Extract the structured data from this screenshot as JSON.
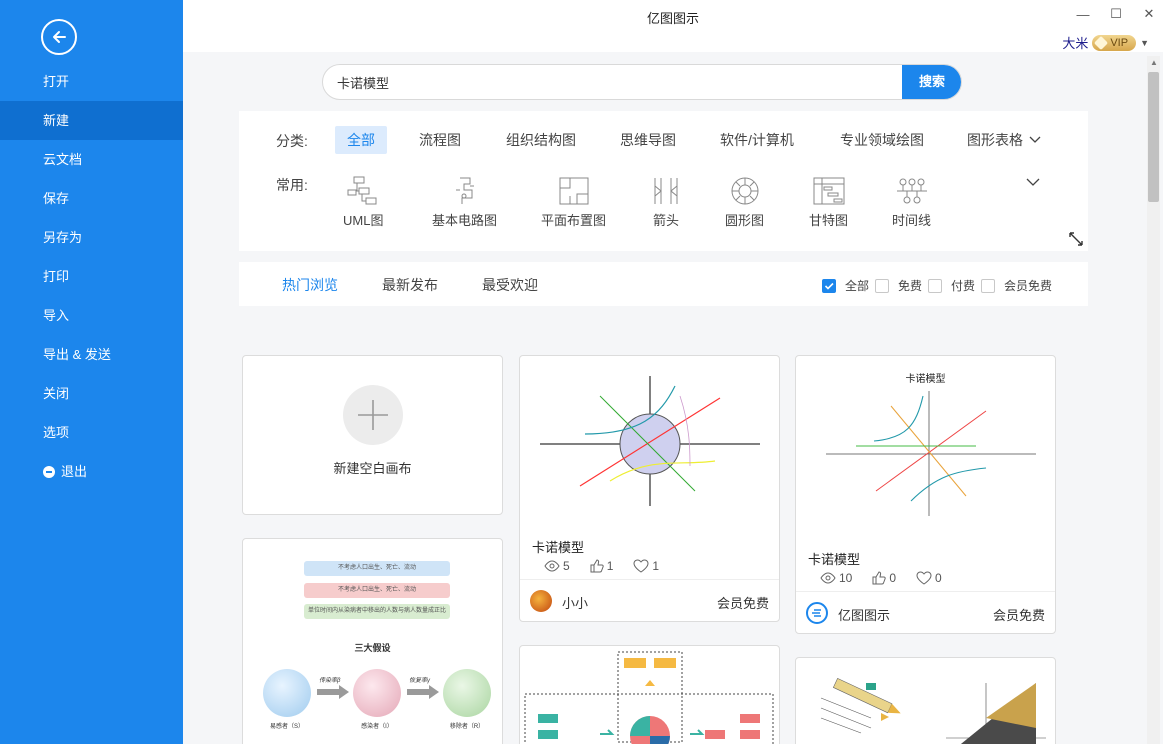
{
  "app": {
    "title": "亿图图示"
  },
  "window_controls": {
    "minimize": "—",
    "maximize": "☐",
    "close": "✕"
  },
  "user": {
    "name": "大米",
    "badge": "VIP"
  },
  "sidebar": {
    "items": [
      {
        "label": "打开"
      },
      {
        "label": "新建",
        "active": true
      },
      {
        "label": "云文档"
      },
      {
        "label": "保存"
      },
      {
        "label": "另存为"
      },
      {
        "label": "打印"
      },
      {
        "label": "导入"
      },
      {
        "label": "导出 & 发送"
      },
      {
        "label": "关闭"
      },
      {
        "label": "选项"
      },
      {
        "label": "退出"
      }
    ]
  },
  "search": {
    "value": "卡诺模型",
    "button": "搜索"
  },
  "categories": {
    "label": "分类:",
    "items": [
      "全部",
      "流程图",
      "组织结构图",
      "思维导图",
      "软件/计算机",
      "专业领域绘图",
      "图形表格"
    ]
  },
  "common": {
    "label": "常用:",
    "items": [
      "UML图",
      "基本电路图",
      "平面布置图",
      "箭头",
      "圆形图",
      "甘特图",
      "时间线"
    ]
  },
  "sort": {
    "tabs": [
      "热门浏览",
      "最新发布",
      "最受欢迎"
    ]
  },
  "filters": [
    {
      "label": "全部",
      "checked": true
    },
    {
      "label": "免费",
      "checked": false
    },
    {
      "label": "付费",
      "checked": false
    },
    {
      "label": "会员免费",
      "checked": false
    }
  ],
  "blank": {
    "label": "新建空白画布"
  },
  "templates": [
    {
      "title": "卡诺模型",
      "views": "5",
      "likes": "1",
      "favorites": "1",
      "author": "小小",
      "price": "会员免费"
    },
    {
      "title": "卡诺模型",
      "views": "10",
      "likes": "0",
      "favorites": "0",
      "author": "亿图图示",
      "price": "会员免费",
      "thumb_title": "卡诺模型"
    }
  ],
  "sir_template": {
    "bars": [
      "不考虑人口出生、死亡、流动",
      "不考虑人口出生、死亡、流动",
      "单位时间内从染病者中移出的人数与病人数量成正比"
    ],
    "heading": "三大假设",
    "nodes": [
      "易感者（S）",
      "感染者（I）",
      "移除者（R）"
    ],
    "arrows": [
      "传染率β",
      "恢复率γ"
    ]
  },
  "colors": {
    "accent": "#1c86ec",
    "sidebar": "#1c86ec",
    "sidebar_active": "#0f6fd0"
  }
}
